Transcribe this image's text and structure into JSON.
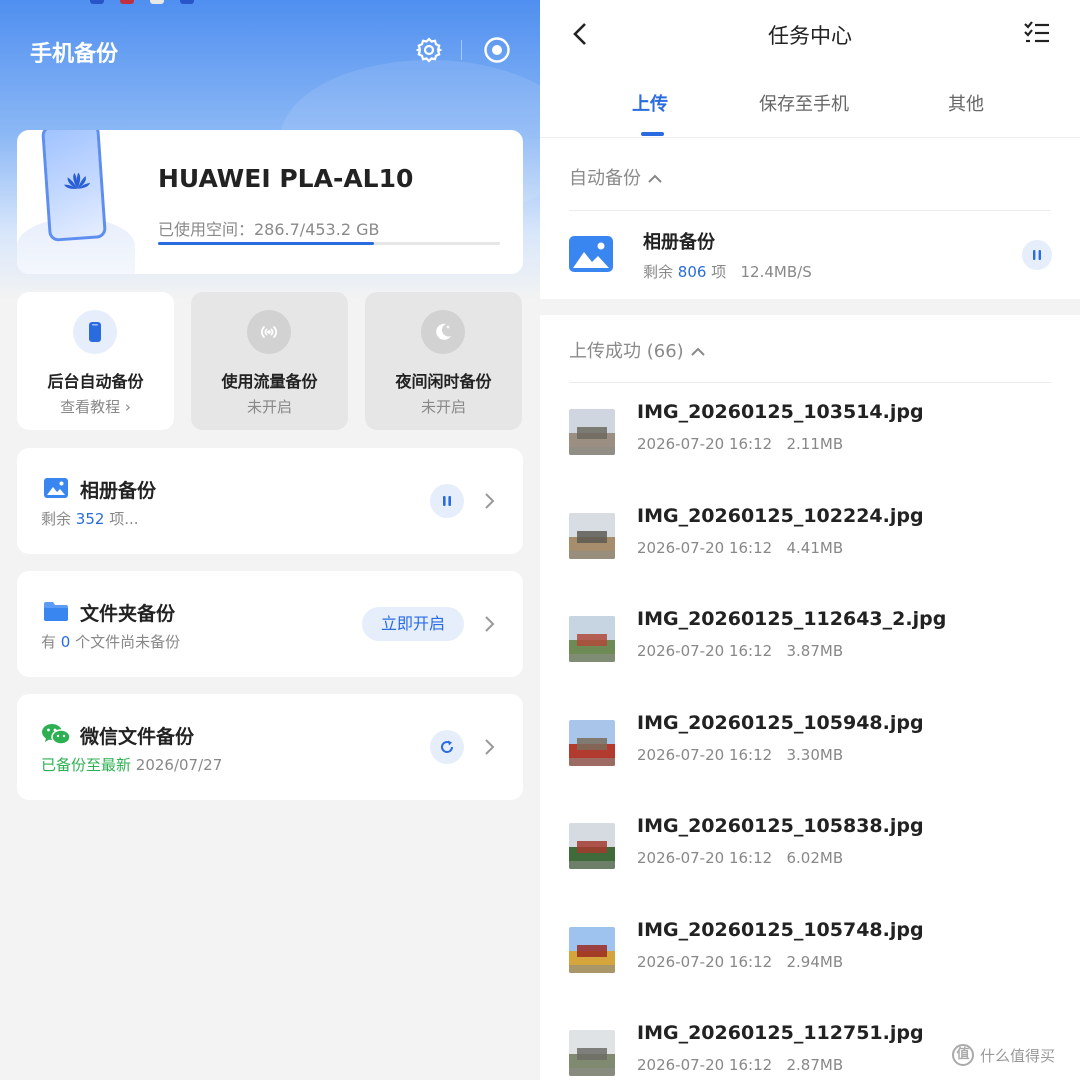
{
  "left": {
    "header": {
      "title": "手机备份",
      "settings_icon": "gear-icon",
      "target_icon": "target-icon"
    },
    "device": {
      "name": "HUAWEI PLA-AL10",
      "storage_label": "已使用空间：286.7/453.2 GB",
      "used_gb": 286.7,
      "total_gb": 453.2
    },
    "features": [
      {
        "label": "后台自动备份",
        "sub": "查看教程 ›",
        "icon": "phone-icon",
        "enabled": true
      },
      {
        "label": "使用流量备份",
        "sub": "未开启",
        "icon": "signal-icon",
        "enabled": false
      },
      {
        "label": "夜间闲时备份",
        "sub": "未开启",
        "icon": "moon-icon",
        "enabled": false
      }
    ],
    "rows": {
      "album": {
        "title": "相册备份",
        "sub_prefix": "剩余 ",
        "count": "352",
        "sub_suffix": " 项...",
        "action_icon": "pause-icon"
      },
      "folder": {
        "title": "文件夹备份",
        "sub_prefix": "有 ",
        "count": "0",
        "sub_suffix": " 个文件尚未备份",
        "action_label": "立即开启"
      },
      "wechat": {
        "title": "微信文件备份",
        "status": "已备份至最新",
        "date": " 2026/07/27",
        "action_icon": "refresh-icon"
      }
    }
  },
  "right": {
    "title": "任务中心",
    "tabs": [
      "上传",
      "保存至手机",
      "其他"
    ],
    "active_tab": 0,
    "auto_section": {
      "header": "自动备份",
      "task": {
        "title": "相册备份",
        "prefix": "剩余 ",
        "count": "806",
        "suffix": " 项",
        "speed": "12.4MB/S"
      }
    },
    "success_section": {
      "header": "上传成功 (66)",
      "files": [
        {
          "name": "IMG_20260125_103514.jpg",
          "time": "2026-07-20 16:12",
          "size": "2.11MB"
        },
        {
          "name": "IMG_20260125_102224.jpg",
          "time": "2026-07-20 16:12",
          "size": "4.41MB"
        },
        {
          "name": "IMG_20260125_112643_2.jpg",
          "time": "2026-07-20 16:12",
          "size": "3.87MB"
        },
        {
          "name": "IMG_20260125_105948.jpg",
          "time": "2026-07-20 16:12",
          "size": "3.30MB"
        },
        {
          "name": "IMG_20260125_105838.jpg",
          "time": "2026-07-20 16:12",
          "size": "6.02MB"
        },
        {
          "name": "IMG_20260125_105748.jpg",
          "time": "2026-07-20 16:12",
          "size": "2.94MB"
        },
        {
          "name": "IMG_20260125_112751.jpg",
          "time": "2026-07-20 16:12",
          "size": "2.87MB"
        }
      ]
    },
    "watermark": {
      "glyph": "值",
      "text": "什么值得买"
    }
  },
  "colors": {
    "accent": "#2a6ce0",
    "success": "#2db052",
    "muted": "#888888"
  }
}
